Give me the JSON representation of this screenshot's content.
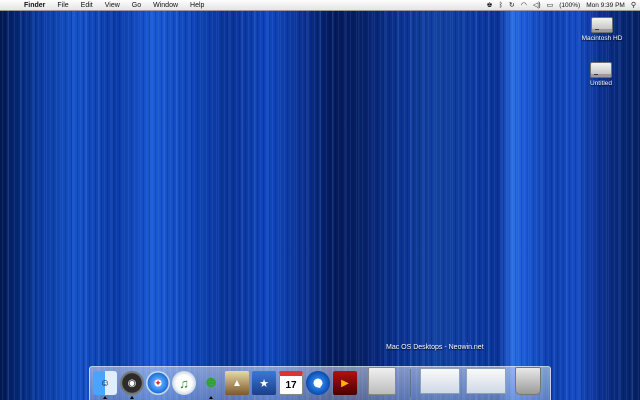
{
  "menubar": {
    "app_name": "Finder",
    "items": [
      "File",
      "Edit",
      "View",
      "Go",
      "Window",
      "Help"
    ],
    "battery": "(100%)",
    "clock": "Mon 9:39 PM"
  },
  "desktop": {
    "icons": [
      {
        "label": "Macintosh HD"
      },
      {
        "label": "Untitled"
      }
    ],
    "caption": "Mac OS Desktops - Neowin.net"
  },
  "dock": {
    "items": [
      {
        "name": "finder",
        "glyph": "☺"
      },
      {
        "name": "dashboard",
        "glyph": "◉"
      },
      {
        "name": "safari",
        "glyph": "✦"
      },
      {
        "name": "itunes",
        "glyph": "♫"
      },
      {
        "name": "adium",
        "glyph": "☻"
      },
      {
        "name": "iphoto",
        "glyph": "▲"
      },
      {
        "name": "imovie",
        "glyph": "★"
      },
      {
        "name": "ical",
        "glyph": "17"
      },
      {
        "name": "quicktime",
        "glyph": "Q"
      },
      {
        "name": "dvd-player",
        "glyph": "▶"
      },
      {
        "name": "system-preferences",
        "glyph": ""
      },
      {
        "name": "minimized-window-1",
        "glyph": ""
      },
      {
        "name": "minimized-window-2",
        "glyph": ""
      },
      {
        "name": "trash",
        "glyph": ""
      }
    ]
  }
}
